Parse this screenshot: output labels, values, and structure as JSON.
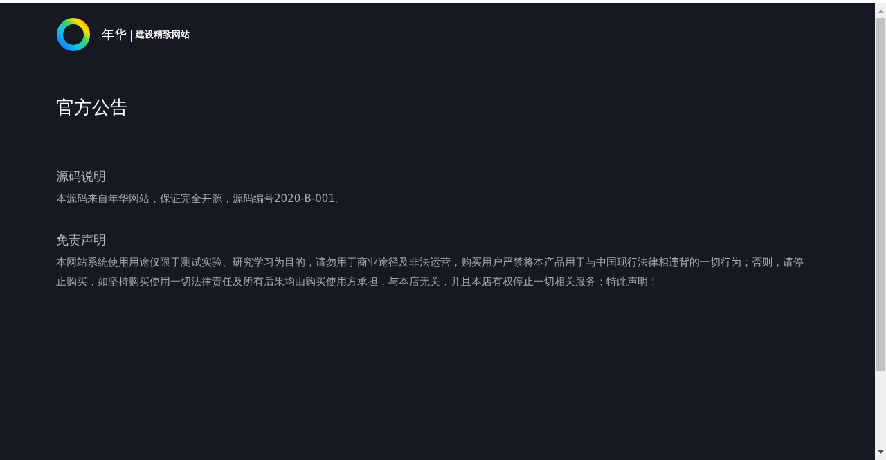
{
  "header": {
    "brand": "年华",
    "separator": "|",
    "slogan": "建设精致网站"
  },
  "page_title": "官方公告",
  "sections": [
    {
      "heading": "源码说明",
      "body": "本源码来自年华网站，保证完全开源，源码编号2020-B-001。"
    },
    {
      "heading": "免责声明",
      "body": "本网站系统使用用途仅限于测试实验、研究学习为目的，请勿用于商业途径及非法运营，购买用户严禁将本产品用于与中国现行法律相违背的一切行为；否则，请停止购买，如坚持购买使用一切法律责任及所有后果均由购买使用方承担，与本店无关，并且本店有权停止一切相关服务；特此声明！"
    }
  ]
}
